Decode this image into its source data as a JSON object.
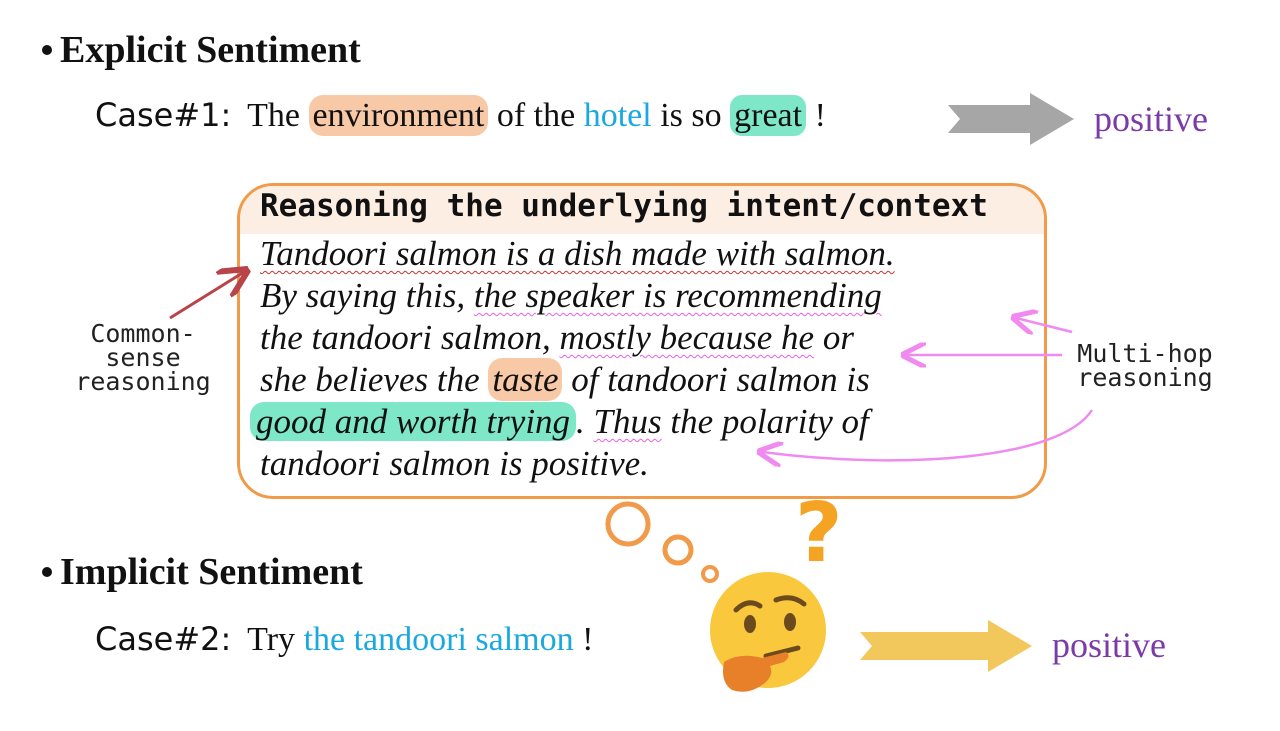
{
  "explicit": {
    "heading": "Explicit Sentiment",
    "case_label": "Case#1:",
    "sentence": {
      "w1": "The",
      "aspect": "environment",
      "w2": "of the",
      "target": "hotel",
      "w3": "is so",
      "opinion": "great",
      "w4": "!"
    },
    "result": "positive",
    "arrow_color": "#a6a6a6"
  },
  "reasoning": {
    "title": "Reasoning the underlying intent/context",
    "line1": "Tandoori salmon is a dish made with salmon.",
    "line2a": "By saying this, ",
    "line2b": "the speaker is recommending",
    "line3a": "the tandoori salmon, ",
    "line3b": "mostly because he",
    "line3c": " or",
    "line4a": "she believes the ",
    "line4b": "taste",
    "line4c": " of tandoori salmon is",
    "line5a": "good and worth trying",
    "line5b": ". ",
    "line5c": "Thus",
    "line5d": " the polarity of",
    "line6": "tandoori salmon is positive.",
    "border_color": "#f09a4a"
  },
  "common_sense": {
    "line1": "Common-",
    "line2": "sense",
    "line3": "reasoning"
  },
  "multi_hop": {
    "line1": "Multi-hop",
    "line2": "reasoning"
  },
  "implicit": {
    "heading": "Implicit Sentiment",
    "case_label": "Case#2:",
    "sentence": {
      "w1": "Try",
      "target": "the tandoori salmon",
      "w2": "!"
    },
    "result": "positive",
    "arrow_color": "#f2c75c"
  },
  "thinking": {
    "question_mark": "?",
    "icon": "thinking-face-icon"
  }
}
